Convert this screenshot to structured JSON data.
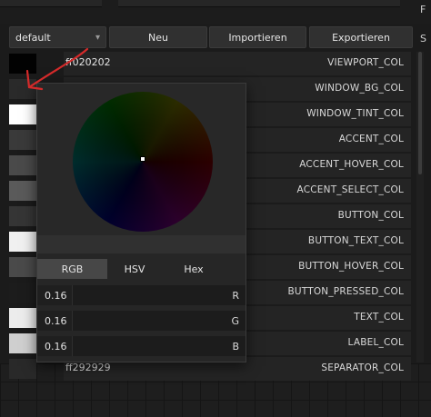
{
  "side_labels": [
    "F",
    "S"
  ],
  "toolbar": {
    "preset_select": "default",
    "caret": "▾",
    "new_label": "Neu",
    "import_label": "Importieren",
    "export_label": "Exportieren"
  },
  "colors": [
    {
      "swatch": "#020202",
      "hex": "ff020202",
      "name": "VIEWPORT_COL"
    },
    {
      "swatch": "#2a2a2a",
      "hex": "",
      "name": "WINDOW_BG_COL"
    },
    {
      "swatch": "#ffffff",
      "hex": "",
      "name": "WINDOW_TINT_COL"
    },
    {
      "swatch": "#3a3a3a",
      "hex": "",
      "name": "ACCENT_COL"
    },
    {
      "swatch": "#4a4a4a",
      "hex": "",
      "name": "ACCENT_HOVER_COL"
    },
    {
      "swatch": "#5a5a5a",
      "hex": "",
      "name": "ACCENT_SELECT_COL"
    },
    {
      "swatch": "#353535",
      "hex": "",
      "name": "BUTTON_COL"
    },
    {
      "swatch": "#f0f0f0",
      "hex": "",
      "name": "BUTTON_TEXT_COL"
    },
    {
      "swatch": "#4a4a4a",
      "hex": "",
      "name": "BUTTON_HOVER_COL"
    },
    {
      "swatch": "#1c1c1c",
      "hex": "",
      "name": "BUTTON_PRESSED_COL"
    },
    {
      "swatch": "#ececec",
      "hex": "",
      "name": "TEXT_COL"
    },
    {
      "swatch": "#cfcfcf",
      "hex": "",
      "name": "LABEL_COL"
    },
    {
      "swatch": "#292929",
      "hex": "ff292929",
      "name": "SEPARATOR_COL"
    }
  ],
  "picker": {
    "tabs": [
      "RGB",
      "HSV",
      "Hex"
    ],
    "active_tab": "RGB",
    "channels": [
      {
        "value": "0.16",
        "label": "R"
      },
      {
        "value": "0.16",
        "label": "G"
      },
      {
        "value": "0.16",
        "label": "B"
      }
    ]
  },
  "annotation_color": "#d42a2a"
}
